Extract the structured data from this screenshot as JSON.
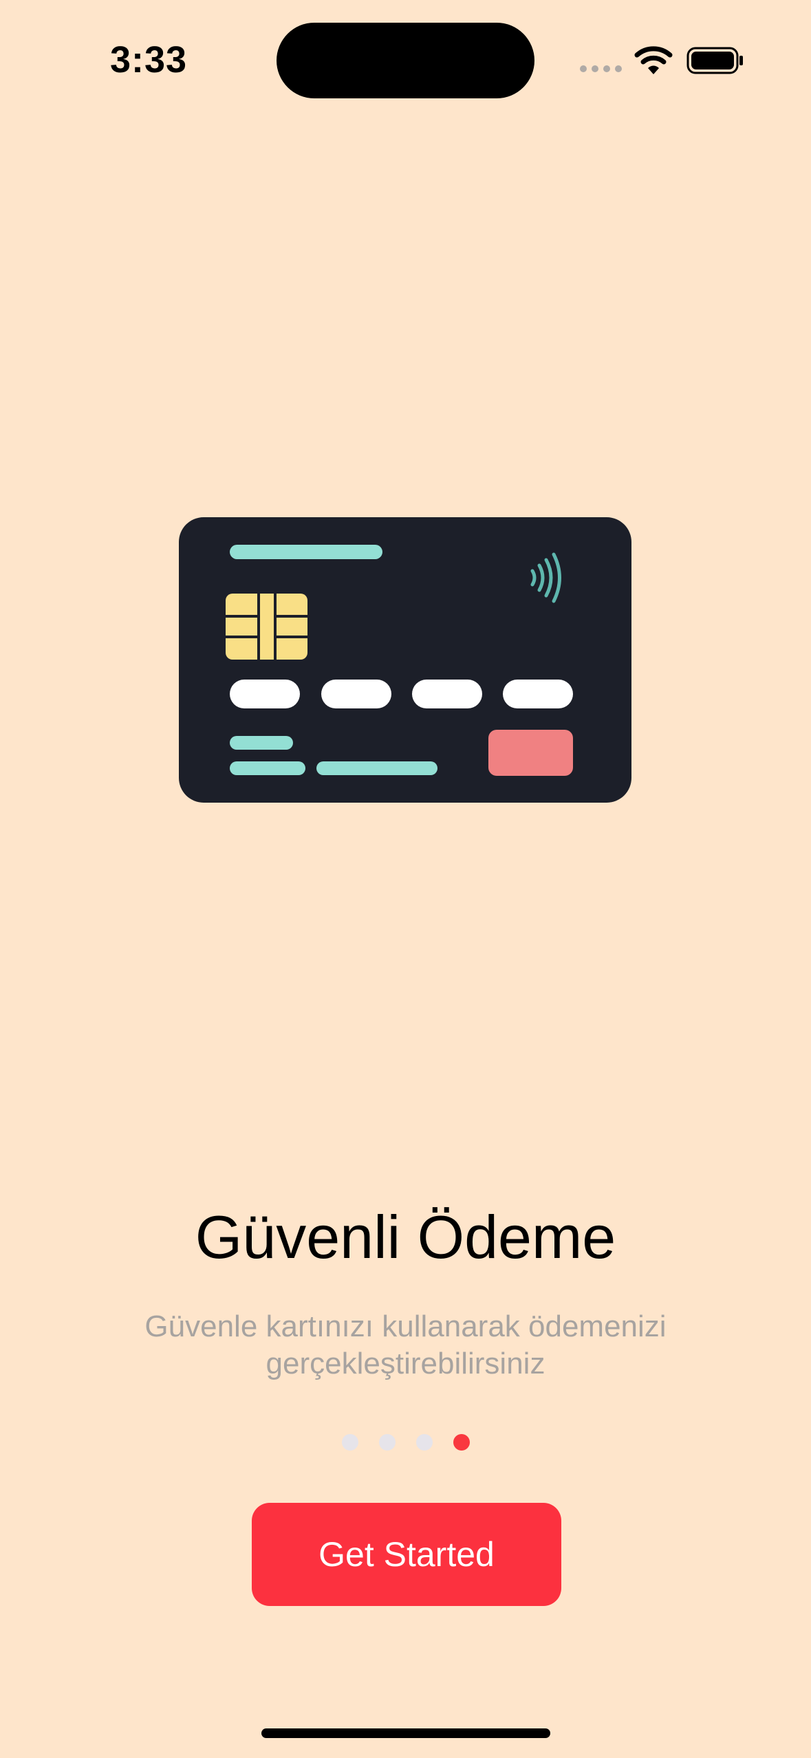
{
  "status_bar": {
    "time": "3:33",
    "icons": [
      "signal-icon",
      "wifi-icon",
      "battery-icon"
    ]
  },
  "illustration": {
    "icon": "credit-card-icon",
    "colors": {
      "card": "#1C1F29",
      "stripe": "#93DFD4",
      "chip": "#F9DF86",
      "number_pills": "#FFFFFF",
      "accent_block": "#F08182",
      "contactless": "#5EB7AE"
    }
  },
  "content": {
    "title": "Güvenli Ödeme",
    "subtitle_line1": "Güvenle kartınızı kullanarak ödemenizi",
    "subtitle_line2": "gerçekleştirebilirsiniz"
  },
  "pager": {
    "count": 4,
    "active_index": 3,
    "active_color": "#F9383F",
    "inactive_color": "#E6E4EA"
  },
  "cta": {
    "label": "Get Started",
    "color": "#FC313F"
  },
  "theme": {
    "background": "#FEE5CB"
  }
}
